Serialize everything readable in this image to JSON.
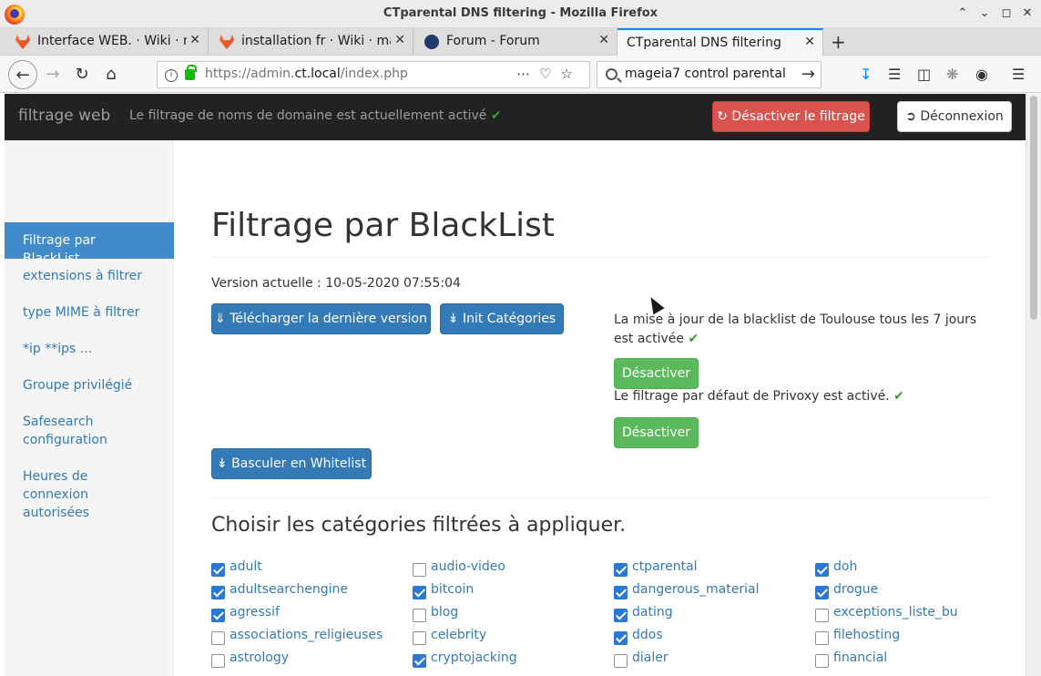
{
  "window": {
    "title": "CTparental DNS filtering - Mozilla Firefox"
  },
  "tabs": [
    {
      "label": "Interface WEB. · Wiki · m",
      "icon": "gitlab-icon"
    },
    {
      "label": "installation fr · Wiki · ma",
      "icon": "gitlab-icon"
    },
    {
      "label": "Forum - Forum",
      "icon": "forum-icon"
    },
    {
      "label": "CTparental DNS filtering",
      "icon": ""
    }
  ],
  "urlbar": {
    "prefix": "https://admin.",
    "domain": "ct.local",
    "path": "/index.php"
  },
  "search": {
    "value": "mageia7 control parental"
  },
  "topnav": {
    "brand": "filtrage web",
    "status": "Le filtrage de noms de domaine est actuellement activé",
    "disable_btn": "Désactiver le filtrage",
    "logout_btn": "Déconnexion"
  },
  "sidebar": {
    "items": [
      {
        "label": "Filtrage par BlackList",
        "active": true
      },
      {
        "label": "extensions à filtrer"
      },
      {
        "label": "type MIME à filtrer"
      },
      {
        "label": "*ip **ips ..."
      },
      {
        "label": "Groupe privilégié"
      },
      {
        "label": "Safesearch configuration"
      },
      {
        "label": "Heures de connexion autorisées"
      }
    ]
  },
  "main": {
    "title": "Filtrage par BlackList",
    "version": "Version actuelle : 10-05-2020 07:55:04",
    "download_btn": "Télécharger la dernière version",
    "init_btn": "Init Catégories",
    "toulouse_text": "La mise à jour de la blacklist de Toulouse tous les 7 jours est activée",
    "disable1_btn": "Désactiver",
    "privoxy_text": "Le filtrage par défaut de Privoxy est activé.",
    "disable2_btn": "Désactiver",
    "whitelist_btn": "Basculer en Whitelist",
    "categories_title": "Choisir les catégories filtrées à appliquer."
  },
  "categories": [
    [
      {
        "name": "adult",
        "checked": true
      },
      {
        "name": "adultsearchengine",
        "checked": true
      },
      {
        "name": "agressif",
        "checked": true
      },
      {
        "name": "associations_religieuses",
        "checked": false
      },
      {
        "name": "astrology",
        "checked": false
      }
    ],
    [
      {
        "name": "audio-video",
        "checked": false
      },
      {
        "name": "bitcoin",
        "checked": true
      },
      {
        "name": "blog",
        "checked": false
      },
      {
        "name": "celebrity",
        "checked": false
      },
      {
        "name": "cryptojacking",
        "checked": true
      }
    ],
    [
      {
        "name": "ctparental",
        "checked": true
      },
      {
        "name": "dangerous_material",
        "checked": true
      },
      {
        "name": "dating",
        "checked": true
      },
      {
        "name": "ddos",
        "checked": true
      },
      {
        "name": "dialer",
        "checked": false
      }
    ],
    [
      {
        "name": "doh",
        "checked": true
      },
      {
        "name": "drogue",
        "checked": true
      },
      {
        "name": "exceptions_liste_bu",
        "checked": false
      },
      {
        "name": "filehosting",
        "checked": false
      },
      {
        "name": "financial",
        "checked": false
      }
    ]
  ]
}
